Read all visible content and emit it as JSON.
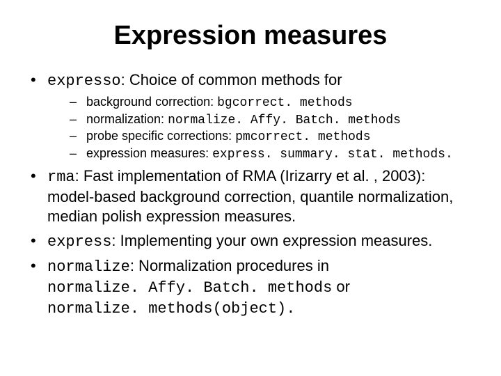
{
  "title": "Expression measures",
  "bullets": {
    "b1": {
      "code": "expresso",
      "text": ": Choice of common methods for",
      "sub": [
        {
          "text": "background correction: ",
          "code": "bgcorrect. methods"
        },
        {
          "text": "normalization: ",
          "code": "normalize. Affy. Batch. methods"
        },
        {
          "text": "probe specific corrections: ",
          "code": "pmcorrect. methods"
        },
        {
          "text": "expression measures: ",
          "code": "express. summary. stat. methods."
        }
      ]
    },
    "b2": {
      "code": "rma",
      "text": ": Fast implementation of RMA (Irizarry et al. , 2003): model-based background correction, quantile normalization, median polish expression measures."
    },
    "b3": {
      "code": "express",
      "text": ": Implementing your own expression measures."
    },
    "b4": {
      "code": "normalize",
      "text_a": ": Normalization procedures in ",
      "code_a": "normalize. Affy. Batch. methods",
      "text_b": " or ",
      "code_b": "normalize. methods(object).",
      "text_c": ""
    }
  }
}
